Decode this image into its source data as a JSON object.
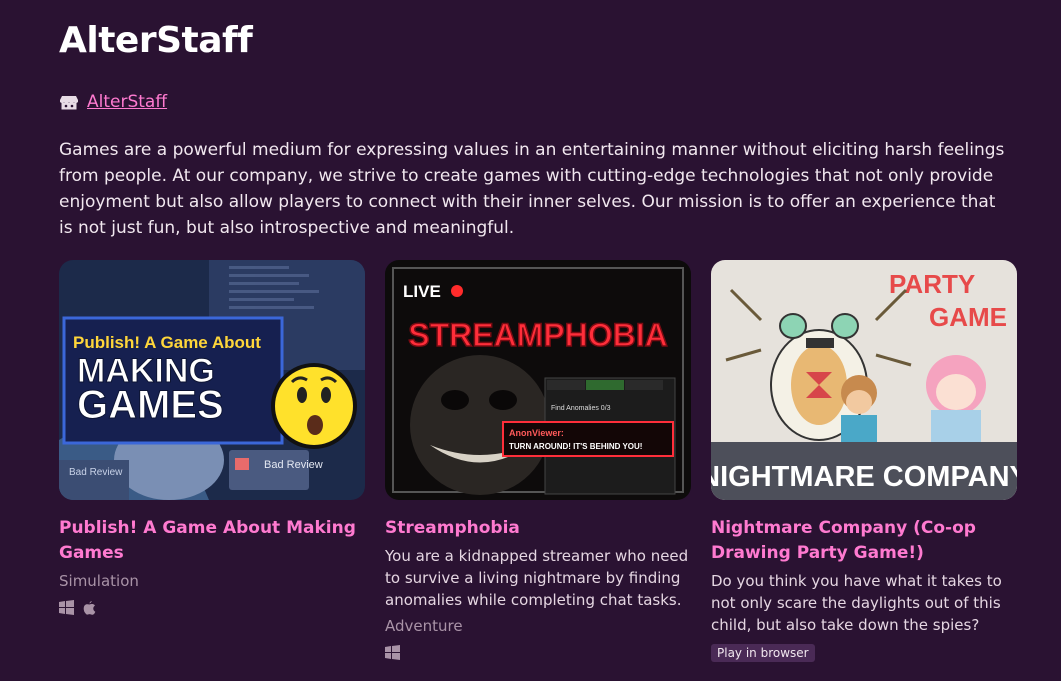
{
  "page": {
    "title": "AlterStaff",
    "author_link": "AlterStaff",
    "description": "Games are a powerful medium for expressing values in an entertaining manner without eliciting harsh feelings from people. At our company, we strive to create games with cutting-edge technologies that not only provide enjoyment but also allow players to connect with their inner selves. Our mission is to offer an experience that is not just fun, but also introspective and meaningful."
  },
  "colors": {
    "background": "#2a1232",
    "accent": "#ff7ad0",
    "muted": "#a993a7"
  },
  "games": [
    {
      "title": "Publish! A Game About Making Games",
      "genre": "Simulation",
      "platforms": [
        "windows-icon",
        "apple-icon"
      ],
      "thumb": {
        "top_text": "Publish! A Game About",
        "main_text_1": "MAKING",
        "main_text_2": "GAMES",
        "bad_review_1": "Bad Review",
        "bad_review_2": "Bad Review"
      }
    },
    {
      "title": "Streamphobia",
      "description": "You are a kidnapped streamer who need to survive a living nightmare by finding anomalies while completing chat tasks.",
      "genre": "Adventure",
      "platforms": [
        "windows-icon"
      ],
      "thumb": {
        "live_label": "LIVE",
        "logo": "STREAMPHOBIA",
        "chat_message_user": "AnonViewer:",
        "chat_message_text": "TURN AROUND! IT'S BEHIND YOU!",
        "task": "Find Anomalies 0/3"
      }
    },
    {
      "title": "Nightmare Company (Co-op Drawing Party Game!)",
      "description": "Do you think you have what it takes to not only scare the daylights out of this child, but also take down the spies?",
      "badge": "Play in browser",
      "thumb": {
        "party_1": "PARTY",
        "party_2": "GAME",
        "logo": "NIGHTMARE COMPANY"
      }
    }
  ]
}
